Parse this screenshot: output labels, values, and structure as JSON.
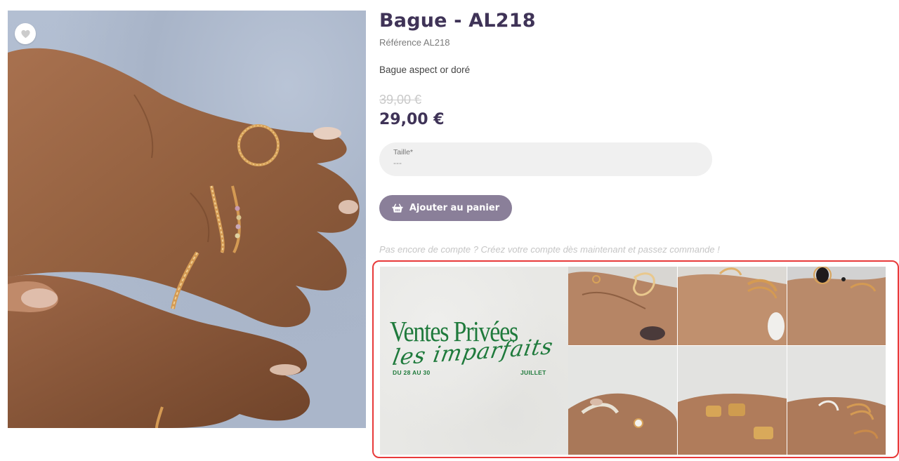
{
  "product": {
    "title": "Bague - AL218",
    "reference": "Référence AL218",
    "description": "Bague aspect or doré",
    "old_price": "39,00 €",
    "price": "29,00 €"
  },
  "options": {
    "size_label": "Taille*",
    "size_value": "---"
  },
  "actions": {
    "add_to_cart_label": "Ajouter au panier"
  },
  "notice": {
    "account_text": "Pas encore de compte ? Créez votre compte dès maintenant et passez commande !"
  },
  "banner": {
    "title": "Ventes Privées",
    "subtitle": "les imparfaits",
    "date_left": "DU 28 AU 30",
    "date_right": "JUILLET"
  },
  "icons": {
    "wishlist": "heart-icon",
    "cart": "basket-icon"
  },
  "colors": {
    "brand_purple": "#3f3357",
    "button_purple": "#8a7f99",
    "banner_green": "#1f7a3c",
    "highlight_red": "#e83a3a"
  }
}
